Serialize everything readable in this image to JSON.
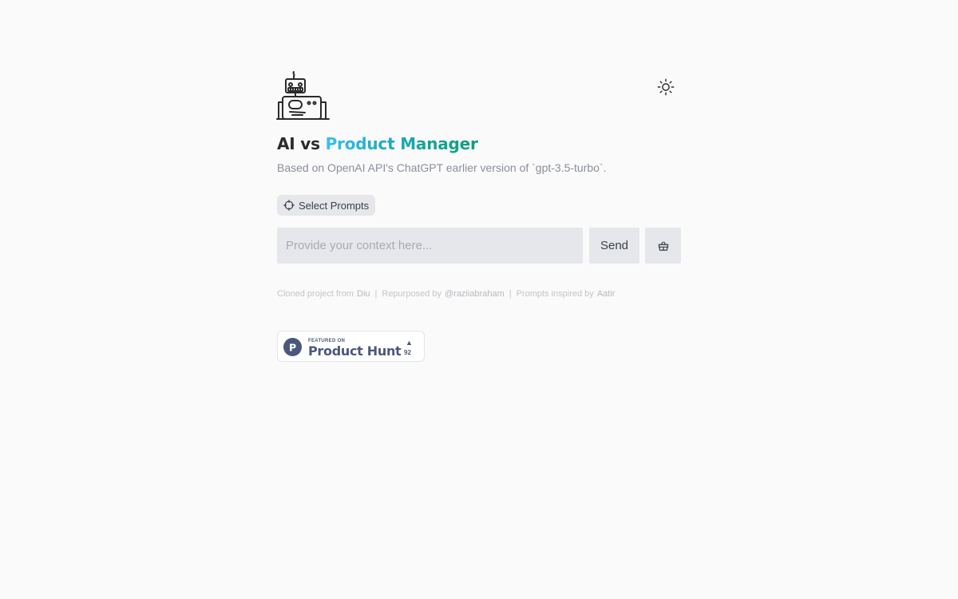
{
  "header": {
    "logo_icon": "robot-icon",
    "theme_toggle_icon": "sun-icon",
    "title_prefix": "AI vs",
    "title_highlight": "Product Manager",
    "subtitle": "Based on OpenAI API's ChatGPT earlier version of `gpt-3.5-turbo`."
  },
  "prompts": {
    "icon": "crosshair-icon",
    "label": "Select Prompts"
  },
  "composer": {
    "placeholder": "Provide your context here...",
    "value": "",
    "send_label": "Send",
    "clear_icon": "basket-icon"
  },
  "footer": {
    "cloned_text": "Cloned project from",
    "cloned_link": "Diu",
    "separator": "|",
    "repurposed_text": "Repurposed by",
    "repurposed_link": "@raziiabraham",
    "inspired_text": "Prompts inspired by",
    "inspired_link": "Aatir"
  },
  "badge": {
    "featured_label": "FEATURED ON",
    "name": "Product Hunt",
    "logo_letter": "P",
    "upvote_arrow": "▲",
    "upvotes": "92"
  },
  "colors": {
    "background": "#fafafa",
    "gradient_start": "#38bdf8",
    "gradient_end": "#0f9d76",
    "button_bg": "#e5e7eb",
    "product_hunt": "#4b587c"
  }
}
